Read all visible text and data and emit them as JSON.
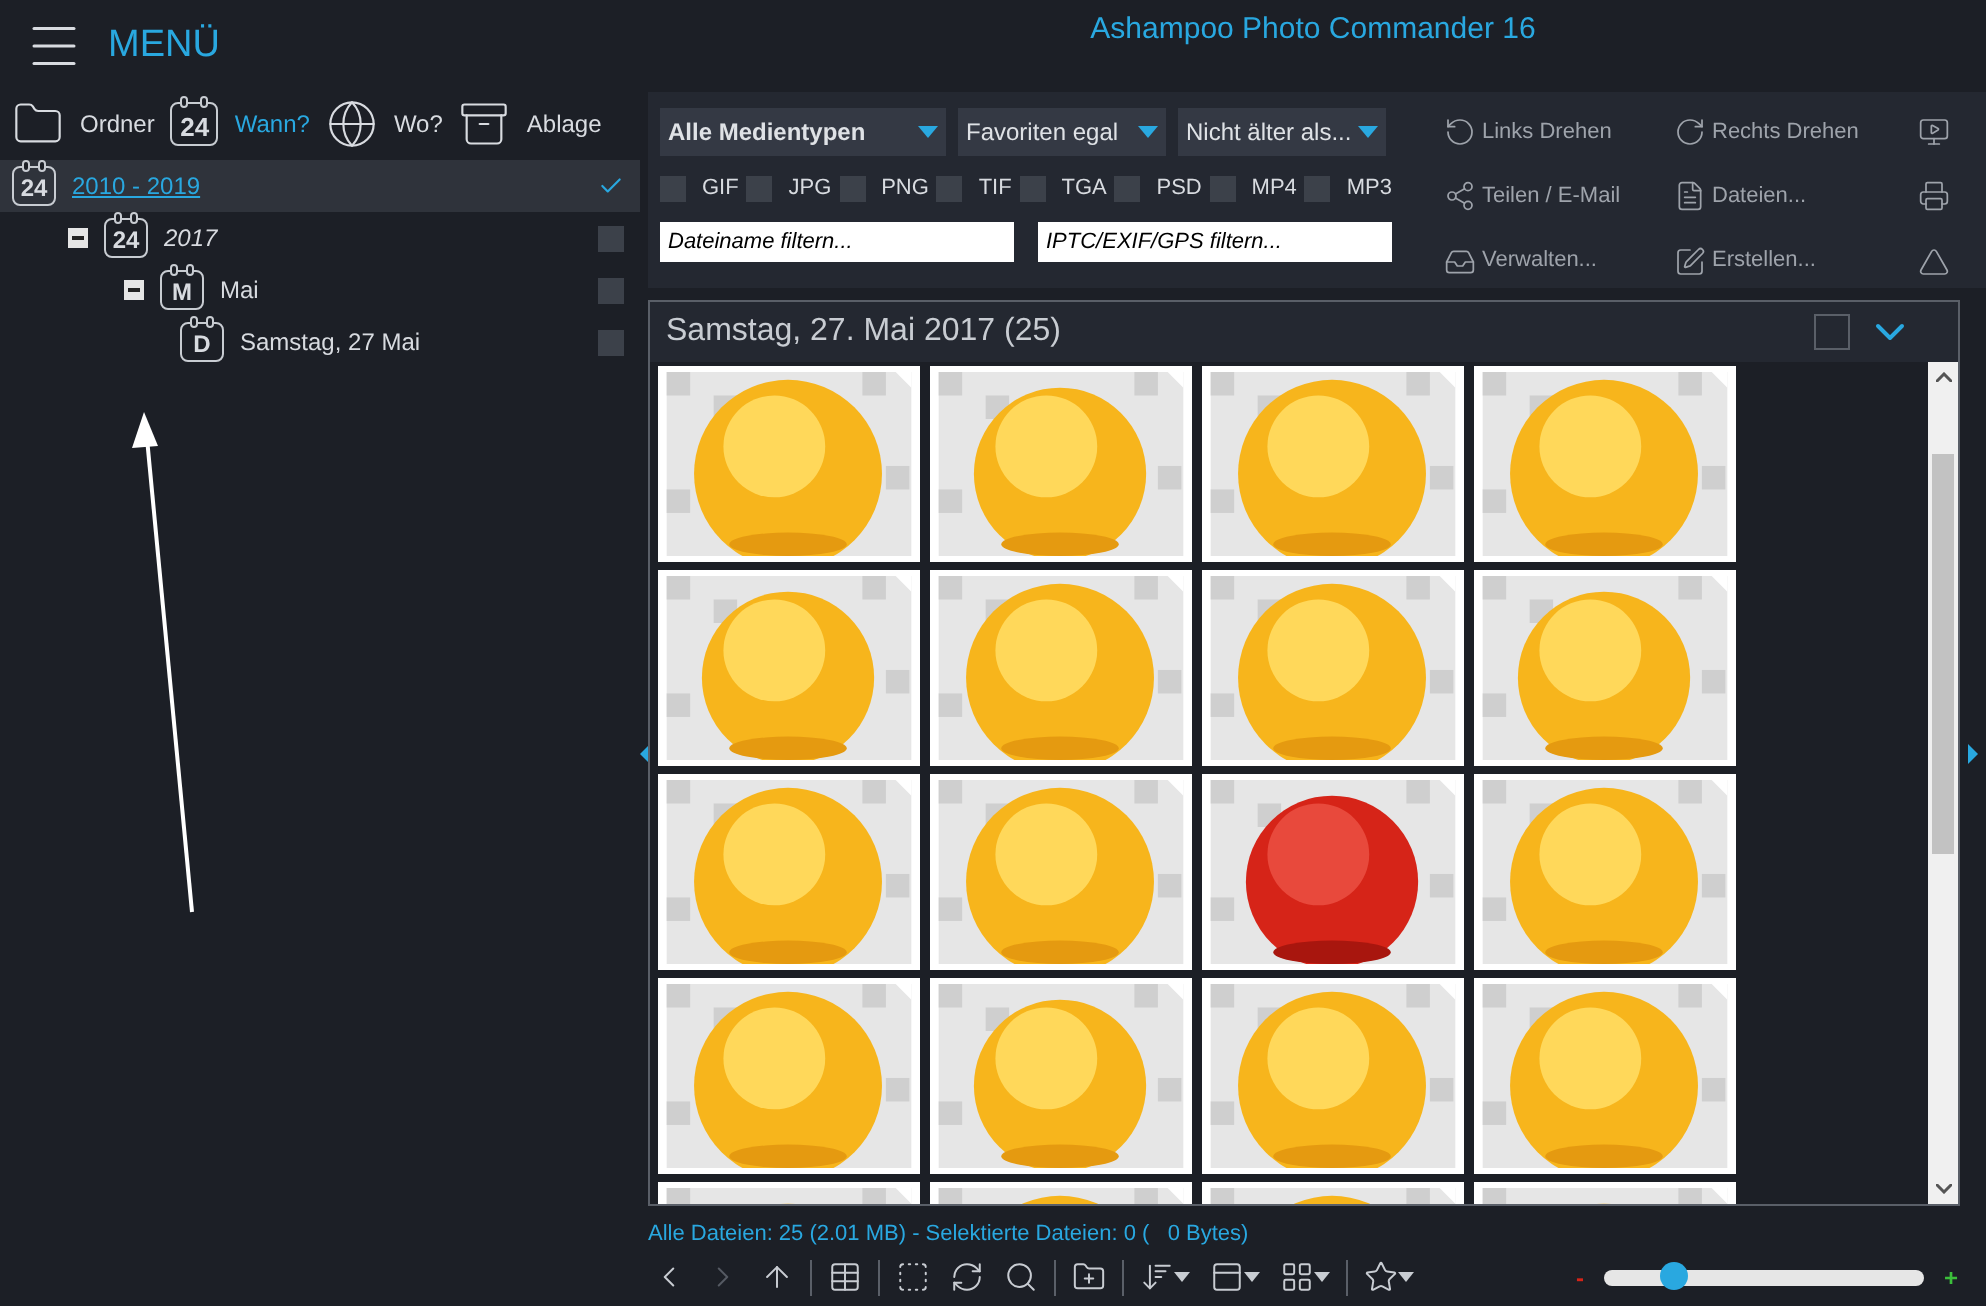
{
  "header": {
    "menu_label": "MENÜ",
    "app_title": "Ashampoo Photo Commander 16"
  },
  "source_tabs": [
    {
      "kind": "folder",
      "label": "Ordner",
      "selected": false
    },
    {
      "kind": "calendar",
      "icon_text": "24",
      "label": "Wann?",
      "selected": true
    },
    {
      "kind": "globe",
      "label": "Wo?",
      "selected": false
    },
    {
      "kind": "tray",
      "label": "Ablage",
      "selected": false
    }
  ],
  "tree": [
    {
      "icon_text": "24",
      "label": "2010 - 2019",
      "selected": true,
      "checked": true,
      "children": [
        {
          "icon_text": "24",
          "label": "2017",
          "expanded": true,
          "selected": false,
          "checked": false,
          "children": [
            {
              "icon_text": "M",
              "label": "Mai",
              "expanded": true,
              "selected": false,
              "checked": false,
              "children": [
                {
                  "icon_text": "D",
                  "label": "Samstag, 27 Mai",
                  "selected": false,
                  "checked": false
                }
              ]
            }
          ]
        }
      ]
    }
  ],
  "dropdowns": [
    {
      "label": "Alle Medientypen",
      "bold": true
    },
    {
      "label": "Favoriten egal",
      "bold": false
    },
    {
      "label": "Nicht älter als...",
      "bold": false
    }
  ],
  "type_filters": [
    {
      "label": "GIF",
      "checked": false
    },
    {
      "label": "JPG",
      "checked": false
    },
    {
      "label": "PNG",
      "checked": false
    },
    {
      "label": "TIF",
      "checked": false
    },
    {
      "label": "TGA",
      "checked": false
    },
    {
      "label": "PSD",
      "checked": false
    },
    {
      "label": "MP4",
      "checked": false
    },
    {
      "label": "MP3",
      "checked": false
    }
  ],
  "search_fields": [
    {
      "placeholder": "Dateiname filtern..."
    },
    {
      "placeholder": "IPTC/EXIF/GPS filtern..."
    }
  ],
  "actions": [
    {
      "kind": "rotate-left",
      "label": "Links Drehen"
    },
    {
      "kind": "rotate-right",
      "label": "Rechts Drehen"
    },
    {
      "kind": "slideshow"
    },
    {
      "kind": "share",
      "label": "Teilen / E-Mail"
    },
    {
      "kind": "file",
      "label": "Dateien..."
    },
    {
      "kind": "print"
    },
    {
      "kind": "manage",
      "label": "Verwalten..."
    },
    {
      "kind": "edit",
      "label": "Erstellen..."
    },
    {
      "kind": "pdf"
    }
  ],
  "gallery": {
    "title": "Samstag, 27. Mai 2017 (25)",
    "select_all_checked": false
  },
  "status": "Alle Dateien: 25 (2.01 MB) - Selektierte Dateien: 0 (   0 Bytes)",
  "bottom_toolbar": [
    {
      "kind": "back",
      "disabled": false
    },
    {
      "kind": "forward",
      "disabled": true
    },
    {
      "kind": "up",
      "disabled": false
    },
    {
      "kind": "sep"
    },
    {
      "kind": "layout",
      "disabled": false
    },
    {
      "kind": "sep"
    },
    {
      "kind": "select",
      "disabled": false
    },
    {
      "kind": "refresh",
      "disabled": false
    },
    {
      "kind": "search",
      "disabled": false
    },
    {
      "kind": "sep"
    },
    {
      "kind": "new-folder",
      "disabled": false
    },
    {
      "kind": "sep"
    },
    {
      "kind": "sort",
      "disabled": false
    },
    {
      "kind": "view",
      "disabled": false
    },
    {
      "kind": "grid",
      "disabled": false
    },
    {
      "kind": "sep"
    },
    {
      "kind": "star",
      "disabled": false
    }
  ],
  "zoom": {
    "minus": "-",
    "plus": "+",
    "level": 0.22
  }
}
